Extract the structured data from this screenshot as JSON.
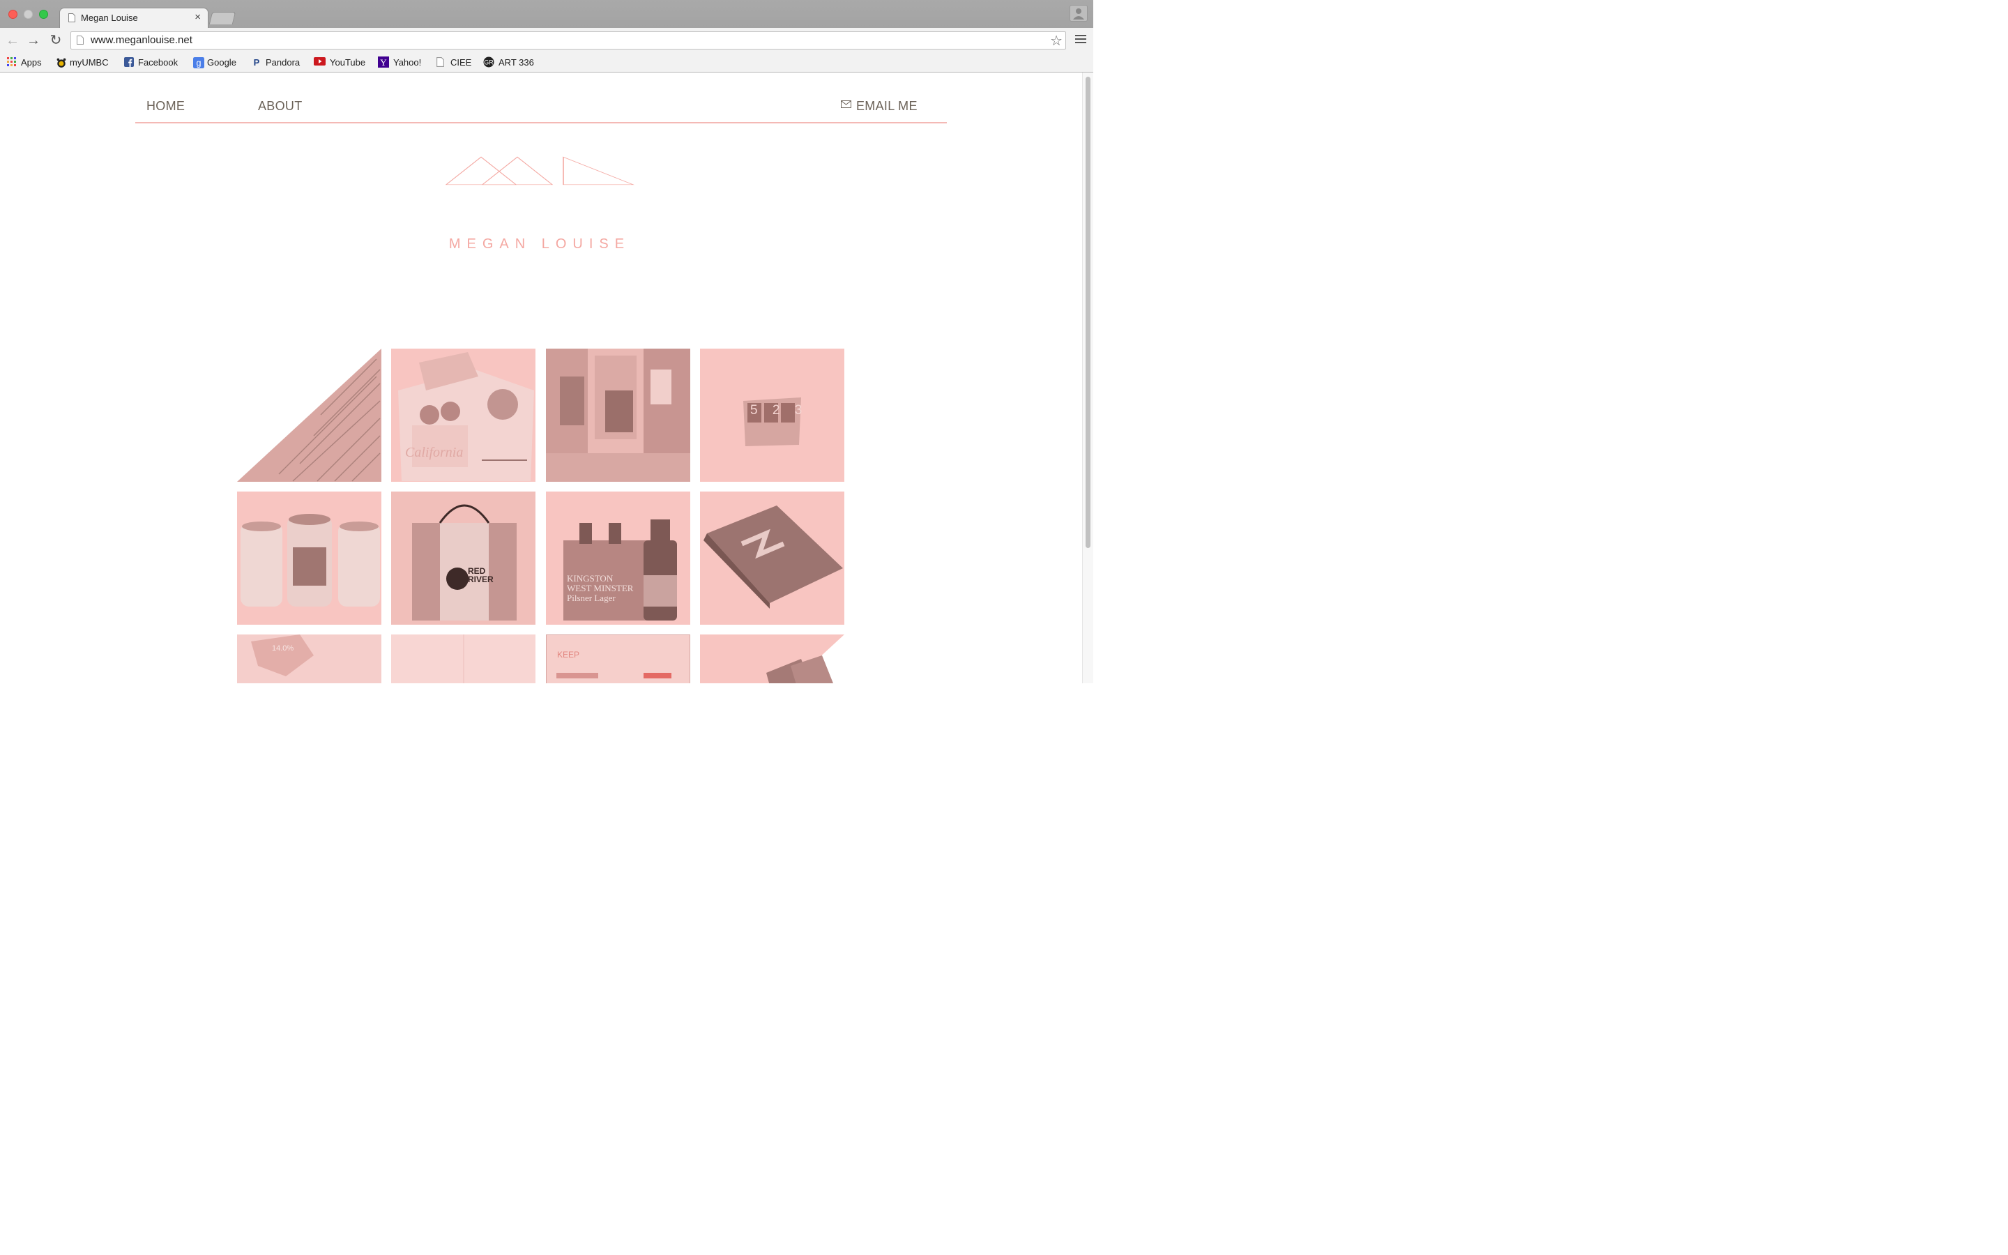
{
  "browser": {
    "tab_title": "Megan Louise",
    "tab_close": "×",
    "url": "www.meganlouise.net",
    "star": "☆",
    "back": "←",
    "forward": "→",
    "reload": "↻",
    "bookmarks": [
      {
        "label": "Apps",
        "icon": "apps-grid-icon"
      },
      {
        "label": "myUMBC",
        "icon": "paw-icon"
      },
      {
        "label": "Facebook",
        "icon": "facebook-icon"
      },
      {
        "label": "Google",
        "icon": "google-icon"
      },
      {
        "label": "Pandora",
        "icon": "pandora-icon"
      },
      {
        "label": "YouTube",
        "icon": "youtube-icon"
      },
      {
        "label": "Yahoo!",
        "icon": "yahoo-icon"
      },
      {
        "label": "CIEE",
        "icon": "page-icon"
      },
      {
        "label": "ART 336",
        "icon": "art-icon"
      }
    ]
  },
  "site": {
    "nav": {
      "home": "HOME",
      "about": "ABOUT",
      "email": "EMAIL ME"
    },
    "logo_text": "MEGAN LOUISE",
    "accent_color": "#f4b9b5",
    "tiles": [
      {
        "name": "dictionary-text",
        "label": ""
      },
      {
        "name": "magazine-spread",
        "label": "California"
      },
      {
        "name": "times-square",
        "label": ""
      },
      {
        "name": "number-cube",
        "label": "5 2 3"
      },
      {
        "name": "tea-tins",
        "label": ""
      },
      {
        "name": "red-river-box",
        "label": "RED RIVER"
      },
      {
        "name": "beer-packaging",
        "label": "KINGSTON WEST MINSTER Pilsner Lager"
      },
      {
        "name": "notebook",
        "label": ""
      },
      {
        "name": "infographic",
        "label": "14.0%"
      },
      {
        "name": "blank-book",
        "label": ""
      },
      {
        "name": "keep-website",
        "label": "KEEP"
      },
      {
        "name": "photo-cards",
        "label": ""
      }
    ]
  }
}
